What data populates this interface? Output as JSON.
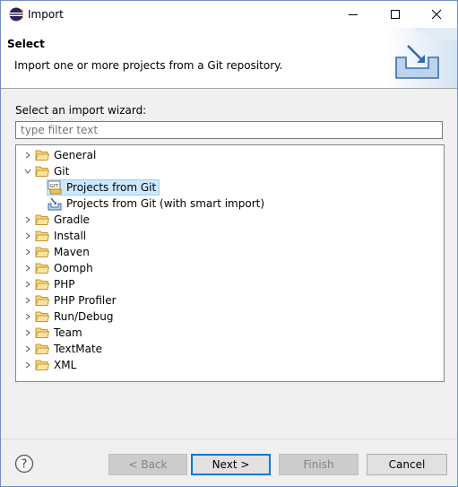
{
  "window": {
    "title": "Import"
  },
  "header": {
    "title": "Select",
    "description": "Import one or more projects from a Git repository."
  },
  "wizard": {
    "label": "Select an import wizard:",
    "filter_placeholder": "type filter text"
  },
  "tree": {
    "general": "General",
    "git": "Git",
    "git_children": [
      "Projects from Git",
      "Projects from Git (with smart import)"
    ],
    "gradle": "Gradle",
    "install": "Install",
    "maven": "Maven",
    "oomph": "Oomph",
    "php": "PHP",
    "php_profiler": "PHP Profiler",
    "run_debug": "Run/Debug",
    "team": "Team",
    "textmate": "TextMate",
    "xml": "XML"
  },
  "buttons": {
    "back": "< Back",
    "next": "Next >",
    "finish": "Finish",
    "cancel": "Cancel"
  },
  "colors": {
    "selection": "#cce8ff",
    "default_button_border": "#0078d7",
    "folder": "#e8b64c"
  }
}
